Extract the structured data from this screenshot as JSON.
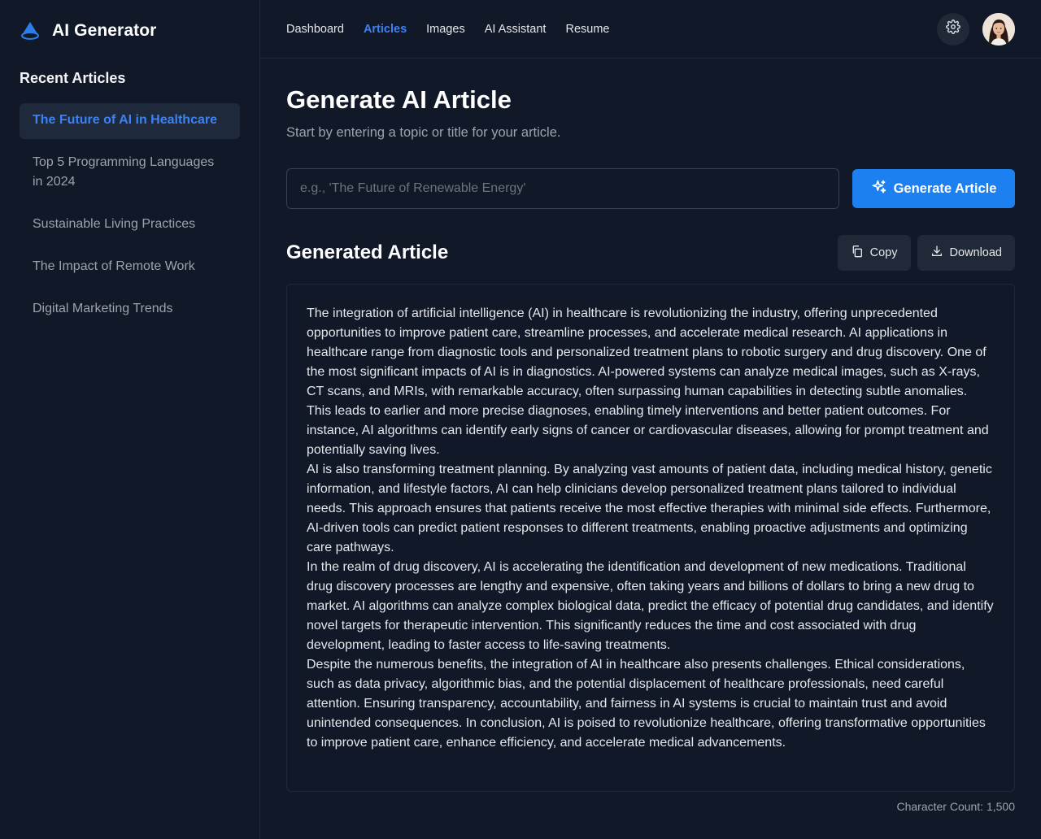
{
  "brand": {
    "name": "AI Generator"
  },
  "sidebar": {
    "title": "Recent Articles",
    "items": [
      {
        "label": "The Future of AI in Healthcare",
        "active": true
      },
      {
        "label": "Top 5 Programming Languages in 2024",
        "active": false
      },
      {
        "label": "Sustainable Living Practices",
        "active": false
      },
      {
        "label": "The Impact of Remote Work",
        "active": false
      },
      {
        "label": "Digital Marketing Trends",
        "active": false
      }
    ]
  },
  "nav": {
    "items": [
      {
        "label": "Dashboard",
        "active": false
      },
      {
        "label": "Articles",
        "active": true
      },
      {
        "label": "Images",
        "active": false
      },
      {
        "label": "AI Assistant",
        "active": false
      },
      {
        "label": "Resume",
        "active": false
      }
    ]
  },
  "topbar": {
    "settings_icon": "gear-icon",
    "avatar": "user-avatar"
  },
  "header": {
    "title": "Generate AI Article",
    "subtitle": "Start by entering a topic or title for your article."
  },
  "generator": {
    "placeholder": "e.g., 'The Future of Renewable Energy'",
    "value": "",
    "button_label": "Generate Article",
    "button_icon": "sparkles-icon"
  },
  "result": {
    "title": "Generated Article",
    "copy_label": "Copy",
    "download_label": "Download",
    "paragraphs": [
      "The integration of artificial intelligence (AI) in healthcare is revolutionizing the industry, offering unprecedented opportunities to improve patient care, streamline processes, and accelerate medical research. AI applications in healthcare range from diagnostic tools and personalized treatment plans to robotic surgery and drug discovery. One of the most significant impacts of AI is in diagnostics. AI-powered systems can analyze medical images, such as X-rays, CT scans, and MRIs, with remarkable accuracy, often surpassing human capabilities in detecting subtle anomalies. This leads to earlier and more precise diagnoses, enabling timely interventions and better patient outcomes. For instance, AI algorithms can identify early signs of cancer or cardiovascular diseases, allowing for prompt treatment and potentially saving lives.",
      "AI is also transforming treatment planning. By analyzing vast amounts of patient data, including medical history, genetic information, and lifestyle factors, AI can help clinicians develop personalized treatment plans tailored to individual needs. This approach ensures that patients receive the most effective therapies with minimal side effects. Furthermore, AI-driven tools can predict patient responses to different treatments, enabling proactive adjustments and optimizing care pathways.",
      "In the realm of drug discovery, AI is accelerating the identification and development of new medications. Traditional drug discovery processes are lengthy and expensive, often taking years and billions of dollars to bring a new drug to market. AI algorithms can analyze complex biological data, predict the efficacy of potential drug candidates, and identify novel targets for therapeutic intervention. This significantly reduces the time and cost associated with drug development, leading to faster access to life-saving treatments.",
      "Despite the numerous benefits, the integration of AI in healthcare also presents challenges. Ethical considerations, such as data privacy, algorithmic bias, and the potential displacement of healthcare professionals, need careful attention. Ensuring transparency, accountability, and fairness in AI systems is crucial to maintain trust and avoid unintended consequences. In conclusion, AI is poised to revolutionize healthcare, offering transformative opportunities to improve patient care, enhance efficiency, and accelerate medical advancements."
    ],
    "char_count": "Character Count: 1,500"
  },
  "colors": {
    "accent": "#1d80f0",
    "active_link": "#3b82f6",
    "bg": "#111827",
    "panel": "#1f2937"
  }
}
